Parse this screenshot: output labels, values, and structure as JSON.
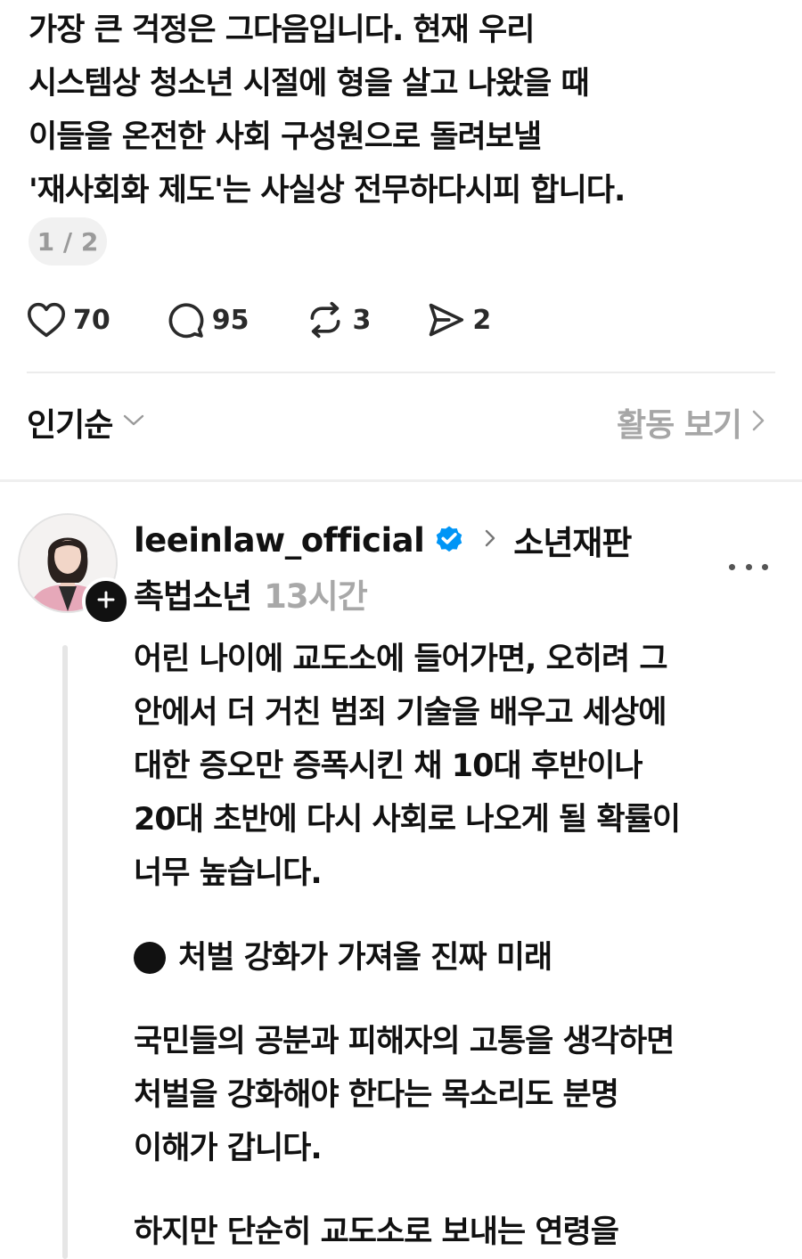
{
  "post": {
    "lines": [
      "가장 큰 걱정은 그다음입니다. 현재 우리",
      "시스템상 청소년 시절에 형을 살고 나왔을 때",
      "이들을 온전한 사회 구성원으로 돌려보낼",
      "'재사회화 제도'는 사실상 전무하다시피 합니다."
    ],
    "page_indicator": "1 / 2"
  },
  "actions": {
    "likes": "70",
    "replies": "95",
    "reposts": "3",
    "shares": "2",
    "icons": [
      "heart-icon",
      "comment-icon",
      "repost-icon",
      "send-icon"
    ]
  },
  "sort": {
    "selected": "인기순",
    "activity_link": "활동 보기"
  },
  "reply": {
    "username": "leeinlaw_official",
    "verified": true,
    "topic": "소년재판",
    "topic2": "촉법소년",
    "time": "13시간",
    "paragraphs": {
      "p1": [
        "어린 나이에 교도소에 들어가면, 오히려 그",
        "안에서 더 거친 범죄 기술을 배우고 세상에",
        "대한 증오만 증폭시킨 채 10대 후반이나",
        "20대 초반에 다시 사회로 나오게 될 확률이",
        "너무 높습니다."
      ],
      "heading": "처벌 강화가 가져올 진짜 미래",
      "p2": [
        "국민들의 공분과 피해자의 고통을 생각하면",
        "처벌을 강화해야 한다는 목소리도 분명",
        "이해가 갑니다."
      ],
      "p3": [
        "하지만 단순히 교도소로 보내는 연령을"
      ]
    }
  },
  "colors": {
    "text": "#111111",
    "muted": "#a6a6a6",
    "verified_blue": "#0095f6",
    "divider": "#ececec"
  }
}
